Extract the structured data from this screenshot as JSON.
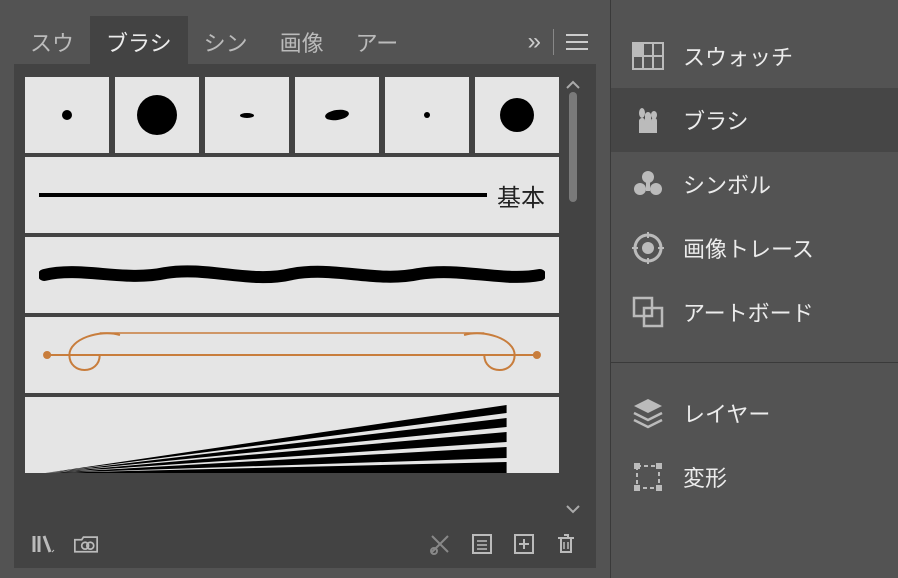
{
  "tabs": {
    "swatch": "スウ",
    "brush": "ブラシ",
    "symbol": "シン",
    "image": "画像",
    "artboard": "アー",
    "more": "»"
  },
  "brush_rows": {
    "basic": "基本"
  },
  "sidebar": {
    "swatch": "スウォッチ",
    "brush": "ブラシ",
    "symbol": "シンボル",
    "image_trace": "画像トレース",
    "artboard": "アートボード",
    "layer": "レイヤー",
    "transform": "変形"
  }
}
